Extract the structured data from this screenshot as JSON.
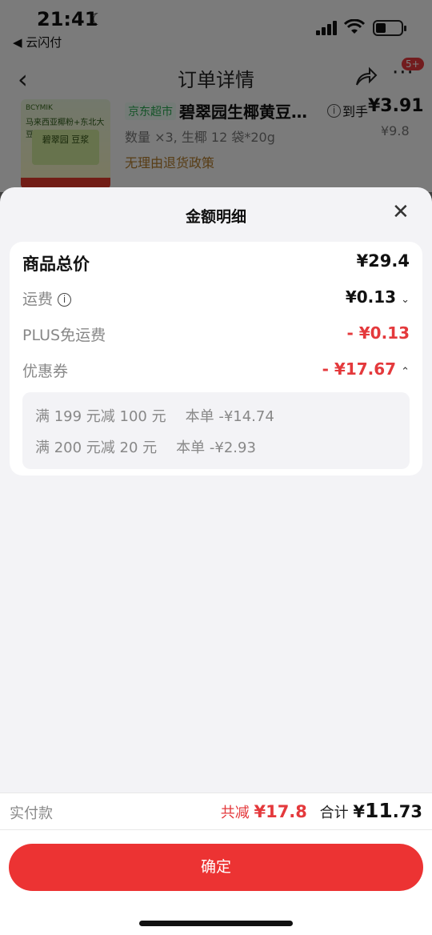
{
  "status_bar": {
    "time": "21:41",
    "back_app": "◀ 云闪付"
  },
  "nav": {
    "title": "订单详情",
    "badge": "5+"
  },
  "product": {
    "store_tag": "京东超市",
    "title": "碧翠园生椰黄豆…",
    "arrival_label": "到手",
    "price": "¥3.91",
    "original_price": "¥9.8",
    "quantity": "数量 ×3, 生椰 12 袋*20g",
    "policy": "无理由退货政策",
    "image_brand": "BCYMIK",
    "image_tagline": "马来西亚椰粉+东北大豆",
    "image_box_text": "碧翠园 豆浆"
  },
  "sheet": {
    "title": "金额明细",
    "total_label": "商品总价",
    "total_value": "¥29.4",
    "shipping_label": "运费",
    "shipping_value": "¥0.13",
    "plus_label": "PLUS免运费",
    "plus_value": "- ¥0.13",
    "coupon_label": "优惠券",
    "coupon_value": "- ¥17.67",
    "coupons": [
      {
        "desc": "满 199 元减 100 元",
        "amount": "本单 -¥14.74"
      },
      {
        "desc": "满 200 元减 20 元",
        "amount": "本单 -¥2.93"
      }
    ]
  },
  "bottom": {
    "paid_label": "实付款",
    "reduce_label": "共减",
    "reduce_value": "¥17.8",
    "total_label": "合计",
    "total_currency": "¥",
    "total_int": "11",
    "total_dec": ".73",
    "confirm_label": "确定"
  },
  "colors": {
    "accent_red": "#e4393c",
    "button_red": "#ec3333"
  }
}
